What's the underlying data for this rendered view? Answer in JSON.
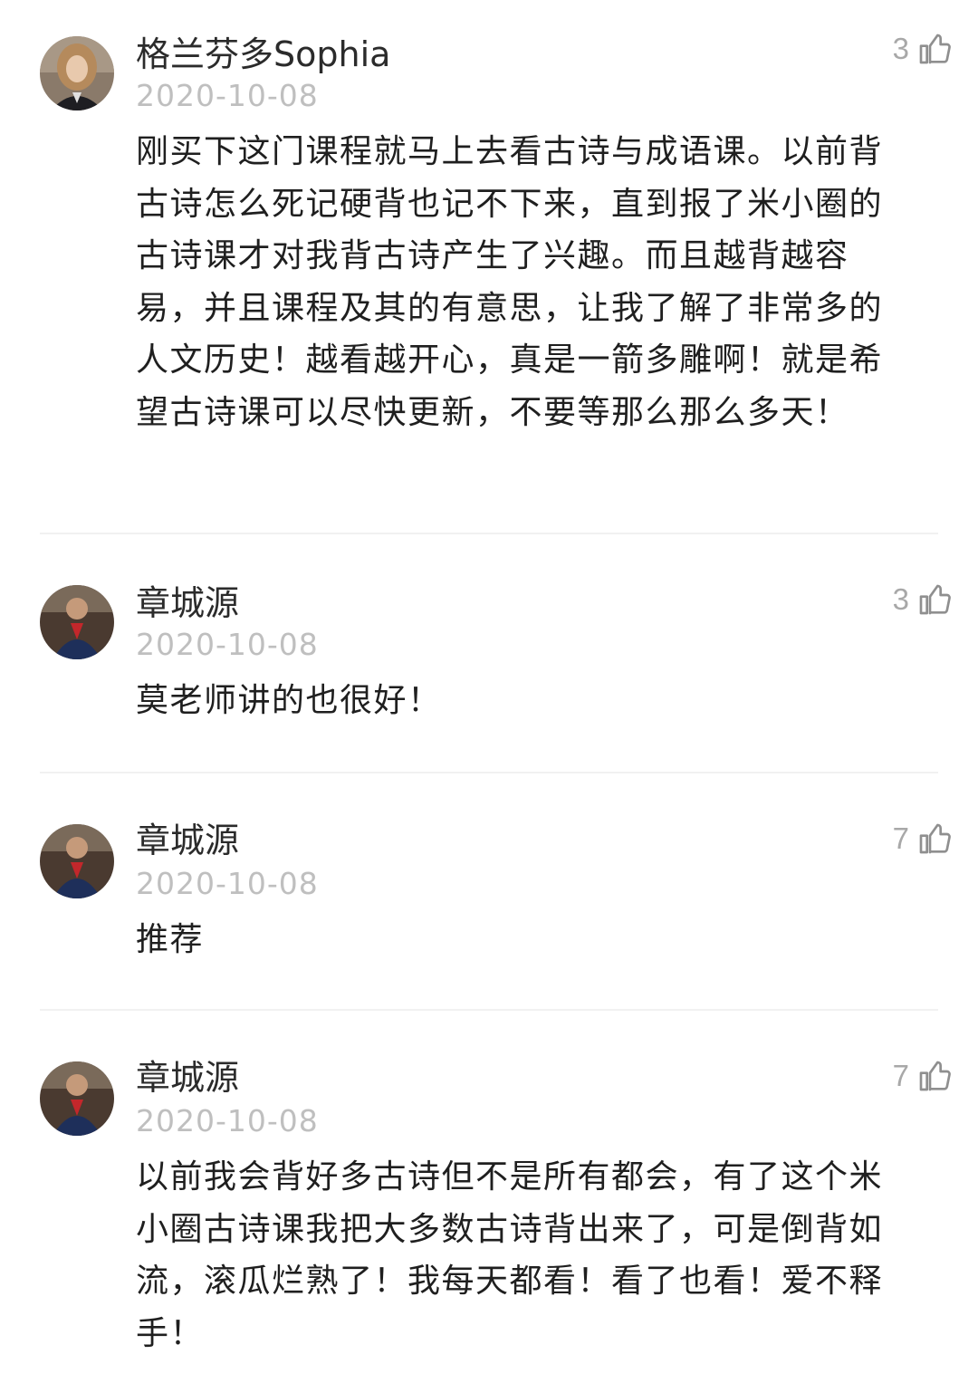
{
  "comments": [
    {
      "name": "格兰芬多Sophia",
      "date": "2020-10-08",
      "likes": "3",
      "text": "刚买下这门课程就马上去看古诗与成语课。以前背古诗怎么死记硬背也记不下来，直到报了米小圈的古诗课才对我背古诗产生了兴趣。而且越背越容易，并且课程及其的有意思，让我了解了非常多的人文历史！越看越开心，真是一箭多雕啊！就是希望古诗课可以尽快更新，不要等那么那么多天！"
    },
    {
      "name": "章城源",
      "date": "2020-10-08",
      "likes": "3",
      "text": "莫老师讲的也很好！"
    },
    {
      "name": "章城源",
      "date": "2020-10-08",
      "likes": "7",
      "text": "推荐"
    },
    {
      "name": "章城源",
      "date": "2020-10-08",
      "likes": "7",
      "text": "以前我会背好多古诗但不是所有都会，有了这个米小圈古诗课我把大多数古诗背出来了，可是倒背如流，滚瓜烂熟了！我每天都看！看了也看！爱不释手！"
    }
  ],
  "icons": {
    "like": "thumbs-up-icon",
    "avatar": "user-avatar"
  },
  "colors": {
    "date": "#bfbfbf",
    "like_count": "#a8a8a8",
    "divider": "#f1f1f1"
  }
}
